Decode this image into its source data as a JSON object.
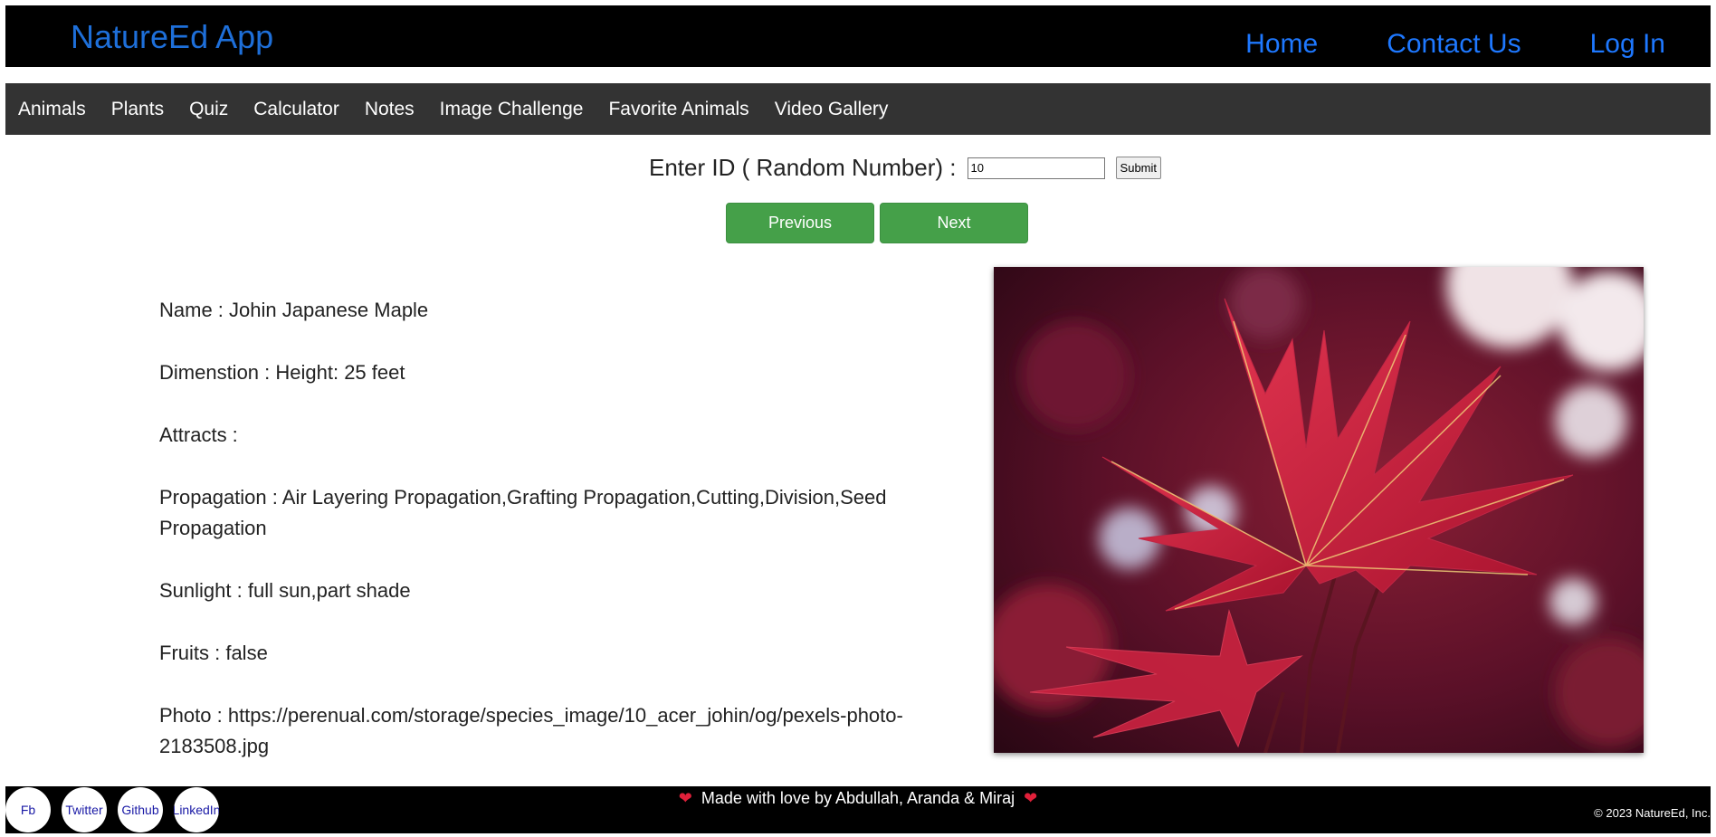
{
  "header": {
    "brand": "NatureEd App",
    "links": [
      "Home",
      "Contact Us",
      "Log In"
    ]
  },
  "menu": {
    "items": [
      "Animals",
      "Plants",
      "Quiz",
      "Calculator",
      "Notes",
      "Image Challenge",
      "Favorite Animals",
      "Video Gallery"
    ]
  },
  "id_form": {
    "label": "Enter ID ( Random Number) :",
    "value": "10",
    "submit_label": "Submit"
  },
  "pager": {
    "previous_label": "Previous",
    "next_label": "Next"
  },
  "plant": {
    "name": "Name : Johin Japanese Maple",
    "dimension": "Dimenstion : Height: 25 feet",
    "attracts": "Attracts :",
    "propagation": "Propagation : Air Layering Propagation,Grafting Propagation,Cutting,Division,Seed Propagation",
    "sunlight": "Sunlight : full sun,part shade",
    "fruits": "Fruits : false",
    "photo": "Photo : https://perenual.com/storage/species_image/10_acer_johin/og/pexels-photo-2183508.jpg"
  },
  "footer": {
    "social": [
      "Fb",
      "Twitter",
      "Github",
      "LinkedIn"
    ],
    "made_with": "Made with love by Abdullah, Aranda & Miraj",
    "heart": "❤",
    "copyright": "© 2023 NatureEd, Inc."
  },
  "colors": {
    "brand": "#1e6fd9",
    "header_link": "#1e78ff",
    "button_green": "#45a049",
    "menubar": "#333333"
  }
}
